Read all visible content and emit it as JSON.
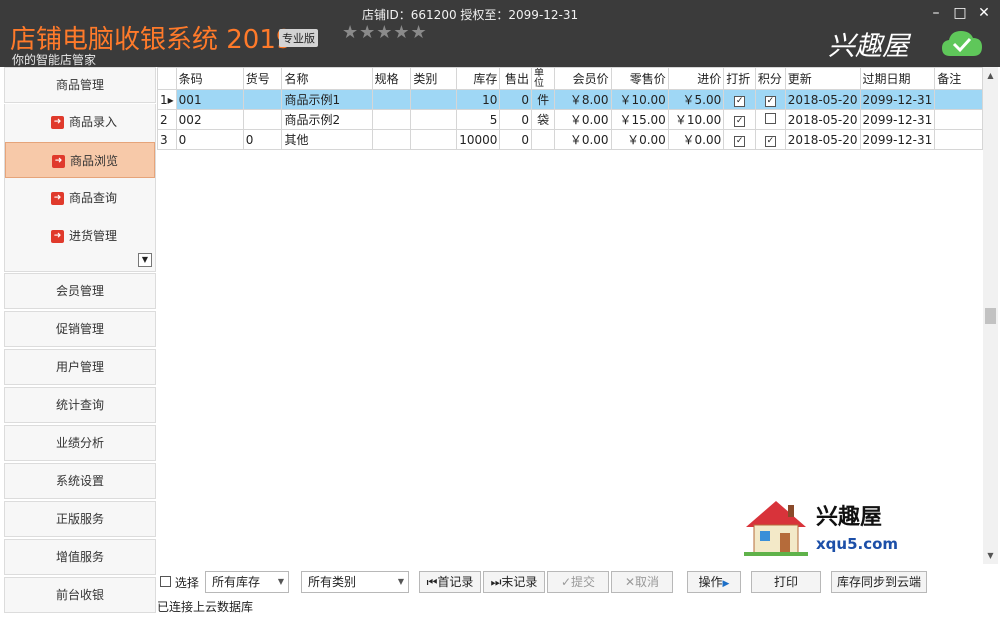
{
  "app": {
    "title": "店铺电脑收银系统 2019",
    "edition": "专业版",
    "subtitle": "你的智能店管家",
    "store_info": "店铺ID：661200 授权至：2099-12-31",
    "stars": "★★★★★",
    "brand": "兴趣屋",
    "window_controls": {
      "minimize": "–",
      "maximize": "□",
      "close": "✕"
    }
  },
  "sidebar": {
    "top_item": "商品管理",
    "sub_items": [
      {
        "label": "商品录入",
        "active": false
      },
      {
        "label": "商品浏览",
        "active": true
      },
      {
        "label": "商品查询",
        "active": false
      },
      {
        "label": "进货管理",
        "active": false
      }
    ],
    "items": [
      "会员管理",
      "促销管理",
      "用户管理",
      "统计查询",
      "业绩分析",
      "系统设置",
      "正版服务",
      "增值服务",
      "前台收银"
    ]
  },
  "grid": {
    "columns": [
      "条码",
      "货号",
      "名称",
      "规格",
      "类别",
      "库存",
      "售出",
      "单位",
      "会员价",
      "零售价",
      "进价",
      "打折",
      "积分",
      "更新",
      "过期日期",
      "备注"
    ],
    "rows": [
      {
        "idx": "1",
        "barcode": "001",
        "sku": "",
        "name": "商品示例1",
        "spec": "",
        "category": "",
        "stock": "10",
        "sold": "0",
        "unit": "件",
        "member_price": "￥8.00",
        "retail_price": "￥10.00",
        "cost": "￥5.00",
        "discount": true,
        "points": true,
        "updated": "2018-05-20",
        "expire": "2099-12-31",
        "note": "",
        "selected": true
      },
      {
        "idx": "2",
        "barcode": "002",
        "sku": "",
        "name": "商品示例2",
        "spec": "",
        "category": "",
        "stock": "5",
        "sold": "0",
        "unit": "袋",
        "member_price": "￥0.00",
        "retail_price": "￥15.00",
        "cost": "￥10.00",
        "discount": true,
        "points": false,
        "updated": "2018-05-20",
        "expire": "2099-12-31",
        "note": "",
        "selected": false
      },
      {
        "idx": "3",
        "barcode": "0",
        "sku": "0",
        "name": "其他",
        "spec": "",
        "category": "",
        "stock": "10000",
        "sold": "0",
        "unit": "",
        "member_price": "￥0.00",
        "retail_price": "￥0.00",
        "cost": "￥0.00",
        "discount": true,
        "points": true,
        "updated": "2018-05-20",
        "expire": "2099-12-31",
        "note": "",
        "selected": false
      }
    ]
  },
  "watermark": {
    "text": "兴趣屋",
    "url": "xqu5.com"
  },
  "toolbar": {
    "select_label": "选择",
    "stock_filter": "所有库存",
    "category_filter": "所有类别",
    "first_record": "首记录",
    "last_record": "末记录",
    "submit": "提交",
    "cancel": "取消",
    "operate": "操作",
    "print": "打印",
    "sync": "库存同步到云端"
  },
  "status": "已连接上云数据库",
  "colors": {
    "titlebar": "#3b3b3b",
    "title_orange": "#ff7a2a",
    "selected_row": "#9fd7f5",
    "active_nav": "#f7c9a9"
  }
}
